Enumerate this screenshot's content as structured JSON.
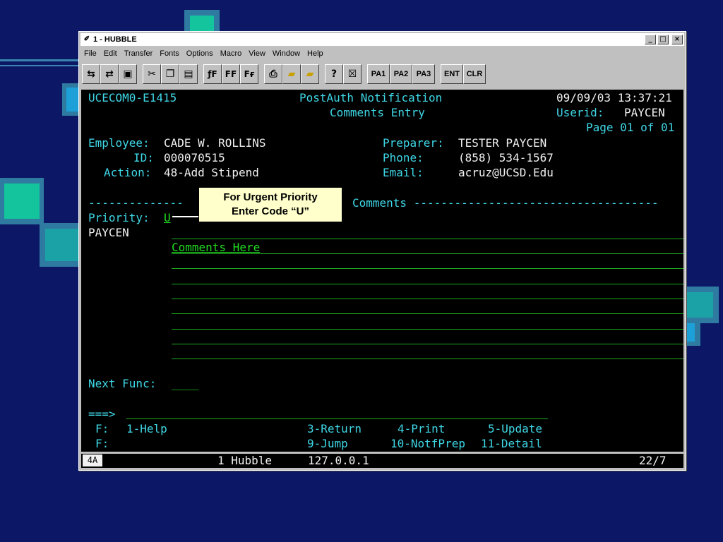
{
  "window": {
    "title": "1 - HUBBLE",
    "buttons": {
      "minimize": "_",
      "maximize": "□",
      "close": "×"
    }
  },
  "menu": [
    "File",
    "Edit",
    "Transfer",
    "Fonts",
    "Options",
    "Macro",
    "View",
    "Window",
    "Help"
  ],
  "toolbar": {
    "pa1": "PA1",
    "pa2": "PA2",
    "pa3": "PA3",
    "ent": "ENT",
    "clr": "CLR"
  },
  "screen": {
    "screen_id": "UCECOM0-E1415",
    "title1": "PostAuth Notification",
    "title2": "Comments Entry",
    "datetime": "09/09/03 13:37:21",
    "userid_label": "Userid:",
    "userid": "PAYCEN",
    "page": "Page 01 of 01",
    "employee_label": "Employee:",
    "employee": "CADE W. ROLLINS",
    "id_label": "ID:",
    "id": "000070515",
    "action_label": "Action:",
    "action": "48-Add Stipend",
    "preparer_label": "Preparer:",
    "preparer": "TESTER PAYCEN",
    "phone_label": "Phone:",
    "phone": "(858) 534-1567",
    "email_label": "Email:",
    "email": "acruz@UCSD.Edu",
    "dashes_left": "--------------",
    "comments_heading": "Comments ------------------------------------",
    "priority_label": "Priority:",
    "priority": "U",
    "author": "PAYCEN",
    "comment_text": "Comments Here",
    "next_func_label": "Next Func:",
    "next_func": "____",
    "prompt": "===>",
    "f_label": "F:",
    "keys_row1": [
      "1-Help",
      "3-Return",
      "4-Print",
      "5-Update"
    ],
    "keys_row2": [
      "9-Jump",
      "10-NotfPrep",
      "11-Detail"
    ]
  },
  "status": {
    "indicator": "4A",
    "session": "1 Hubble",
    "host": "127.0.0.1",
    "position": "22/7"
  },
  "callout": {
    "line1": "For Urgent Priority",
    "line2": "Enter Code “U”"
  }
}
